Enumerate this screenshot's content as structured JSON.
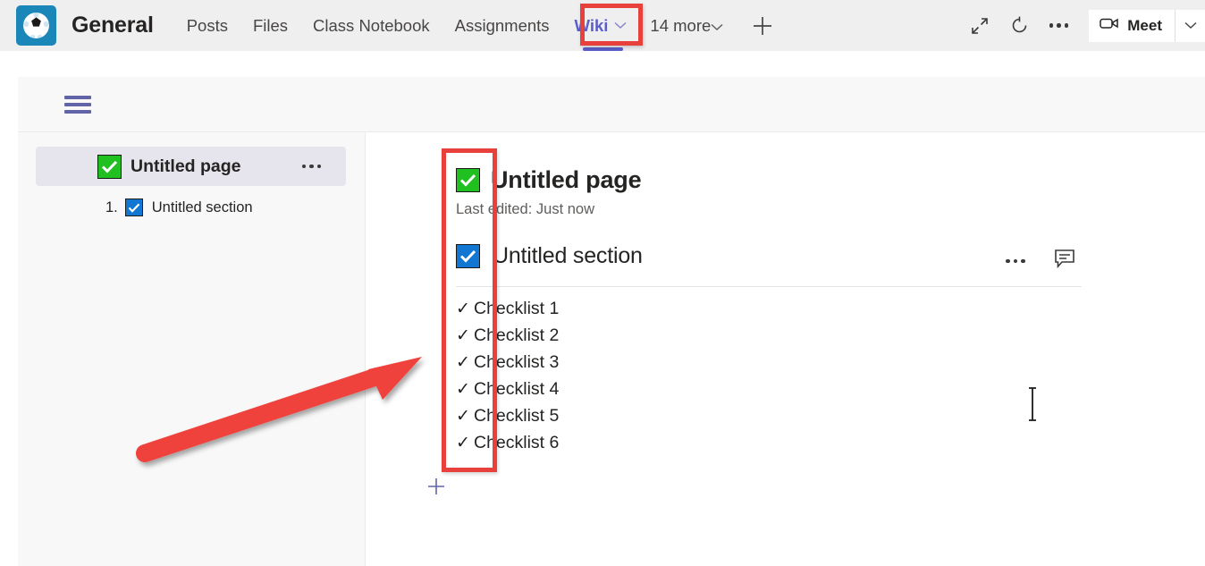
{
  "app": {
    "team_name": "General",
    "team_icon": "soccer-ball-icon",
    "accent_purple": "#5b5fc7",
    "annotation_red": "#e8403a"
  },
  "tabs": [
    {
      "label": "Posts",
      "active": false
    },
    {
      "label": "Files",
      "active": false
    },
    {
      "label": "Class Notebook",
      "active": false
    },
    {
      "label": "Assignments",
      "active": false
    },
    {
      "label": "Wiki",
      "active": true
    }
  ],
  "tab_overflow": {
    "label": "14 more",
    "chevron_icon": "chevron-down-icon"
  },
  "add_tab": {
    "icon": "plus-icon"
  },
  "toolbar": {
    "expand_icon": "expand-diagonal-icon",
    "refresh_icon": "refresh-circular-arrow-icon",
    "more_icon": "more-horizontal-icon",
    "meet_label": "Meet",
    "meet_icon": "video-camera-icon",
    "meet_chevron_icon": "chevron-down-icon"
  },
  "wiki_header": {
    "menu_icon": "hamburger-menu-icon"
  },
  "sidebar": {
    "page": {
      "label": "Untitled page",
      "checkbox": "green-checked-checkbox",
      "more_icon": "more-horizontal-icon"
    },
    "section": {
      "number": "1.",
      "label": "Untitled section",
      "checkbox": "blue-checked-checkbox"
    }
  },
  "content": {
    "page_title": "Untitled page",
    "page_checkbox": "green-checked-checkbox",
    "last_edited": "Last edited: Just now",
    "section_title": "Untitled section",
    "section_checkbox": "blue-checked-checkbox",
    "section_more_icon": "more-horizontal-icon",
    "section_comment_icon": "comment-bubble-icon",
    "checklist": [
      {
        "tick": "✓",
        "text": "Checklist 1"
      },
      {
        "tick": "✓",
        "text": "Checklist 2"
      },
      {
        "tick": "✓",
        "text": "Checklist 3"
      },
      {
        "tick": "✓",
        "text": "Checklist 4"
      },
      {
        "tick": "✓",
        "text": "Checklist 5"
      },
      {
        "tick": "✓",
        "text": "Checklist 6"
      }
    ],
    "add_block_icon": "plus-icon"
  },
  "annotations": {
    "tab_highlight": "red-rectangle-around-wiki-tab",
    "column_highlight": "red-rectangle-around-checklist-column",
    "arrow": "red-arrow-pointing-to-checklist"
  }
}
